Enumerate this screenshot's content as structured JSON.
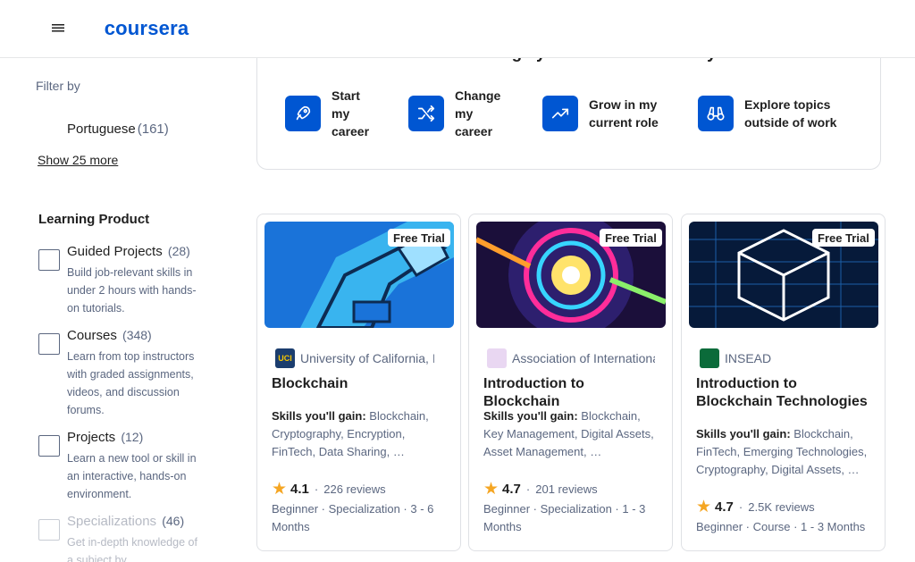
{
  "header": {
    "logo": "coursera"
  },
  "sidebar": {
    "filter_by": "Filter by",
    "language_item": {
      "label": "Portuguese",
      "count": "(161)"
    },
    "show_more": "Show 25 more",
    "learning_product": {
      "title": "Learning Product",
      "items": [
        {
          "label": "Guided Projects",
          "count": "(28)",
          "desc": "Build job-relevant skills in under 2 hours with hands-on tutorials."
        },
        {
          "label": "Courses",
          "count": "(348)",
          "desc": "Learn from top instructors with graded assignments, videos, and discussion forums."
        },
        {
          "label": "Projects",
          "count": "(12)",
          "desc": "Learn a new tool or skill in an interactive, hands-on environment."
        },
        {
          "label": "Specializations",
          "count": "(46)",
          "desc": "Get in-depth knowledge of a subject by"
        }
      ]
    }
  },
  "intent": {
    "title": "What brings you to Coursera today?",
    "options": [
      {
        "label": "Start my career",
        "icon": "rocket-icon"
      },
      {
        "label": "Change my career",
        "icon": "shuffle-icon"
      },
      {
        "label": "Grow in my current role",
        "icon": "trending-up-icon"
      },
      {
        "label": "Explore topics outside of work",
        "icon": "binoculars-icon"
      }
    ]
  },
  "cards": [
    {
      "badge": "Free Trial",
      "partner_logo": "UCI",
      "partner": "University of California, Irvine",
      "title": "Blockchain",
      "skills_label": "Skills you'll gain:",
      "skills": "Blockchain, Cryptography, Encryption, FinTech, Data Sharing, …",
      "rating": "4.1",
      "reviews": "226 reviews",
      "meta": "Beginner · Specialization · 3 - 6 Months"
    },
    {
      "badge": "Free Trial",
      "partner_logo": "",
      "partner": "Association of International Certified Professional Accountants",
      "title": "Introduction to Blockchain",
      "skills_label": "Skills you'll gain:",
      "skills": "Blockchain, Key Management, Digital Assets, Asset Management, …",
      "rating": "4.7",
      "reviews": "201 reviews",
      "meta": "Beginner · Specialization · 1 - 3 Months"
    },
    {
      "badge": "Free Trial",
      "partner_logo": "INSEAD",
      "partner": "INSEAD",
      "title": "Introduction to Blockchain Technologies",
      "skills_label": "Skills you'll gain:",
      "skills": "Blockchain, FinTech, Emerging Technologies, Cryptography, Digital Assets, …",
      "rating": "4.7",
      "reviews": "2.5K reviews",
      "meta": "Beginner · Course · 1 - 3 Months"
    }
  ],
  "colors": {
    "brand": "#0056d2",
    "star": "#f5a623",
    "muted": "#5b6780"
  }
}
